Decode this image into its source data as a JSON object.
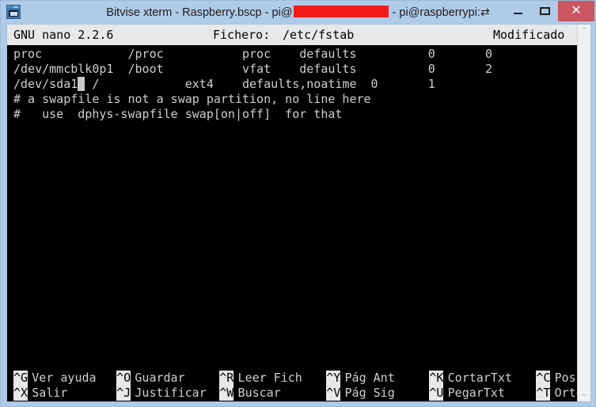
{
  "window": {
    "title_prefix": "Bitvise xterm - Raspberry.bscp - pi@",
    "title_redacted": "",
    "title_suffix": " - pi@raspberrypi:",
    "title_glyph": "⇄",
    "app_icon": "terminal-window-icon",
    "buttons": {
      "minimize": "−",
      "maximize": "▢",
      "close": "✕"
    },
    "colors": {
      "chrome": "#b0cbe8",
      "close_button": "#cb5560",
      "redaction": "#ef1a1a",
      "terminal_bg": "#000000",
      "terminal_fg": "#cfcfcf",
      "inverse_bg": "#e8e8e8"
    }
  },
  "nano": {
    "header": {
      "version": "GNU nano 2.2.6",
      "file_label": "Fichero:",
      "file_path": "/etc/fstab",
      "status": "Modificado"
    },
    "lines": [
      {
        "text": "proc            /proc           proc    defaults          0       0",
        "cursor_col": -1
      },
      {
        "text": "/dev/mmcblk0p1  /boot           vfat    defaults          0       2",
        "cursor_col": -1
      },
      {
        "text": "/dev/sda1  /            ext4    defaults,noatime  0       1",
        "cursor_col": 9
      },
      {
        "text": "# a swapfile is not a swap partition, no line here",
        "cursor_col": -1
      },
      {
        "text": "#   use  dphys-swapfile swap[on|off]  for that",
        "cursor_col": -1
      }
    ],
    "shortcuts_row1": [
      {
        "key": "^G",
        "label": "Ver ayuda"
      },
      {
        "key": "^O",
        "label": "Guardar"
      },
      {
        "key": "^R",
        "label": "Leer Fich"
      },
      {
        "key": "^Y",
        "label": "Pág Ant"
      },
      {
        "key": "^K",
        "label": "CortarTxt"
      },
      {
        "key": "^C",
        "label": "Pos actual"
      }
    ],
    "shortcuts_row2": [
      {
        "key": "^X",
        "label": "Salir"
      },
      {
        "key": "^J",
        "label": "Justificar"
      },
      {
        "key": "^W",
        "label": "Buscar"
      },
      {
        "key": "^V",
        "label": "Pág Sig"
      },
      {
        "key": "^U",
        "label": "PegarTxt"
      },
      {
        "key": "^T",
        "label": "Ortografía"
      }
    ]
  },
  "scrollbar": {
    "up_arrow": "⌃",
    "down_arrow": "⌄"
  }
}
